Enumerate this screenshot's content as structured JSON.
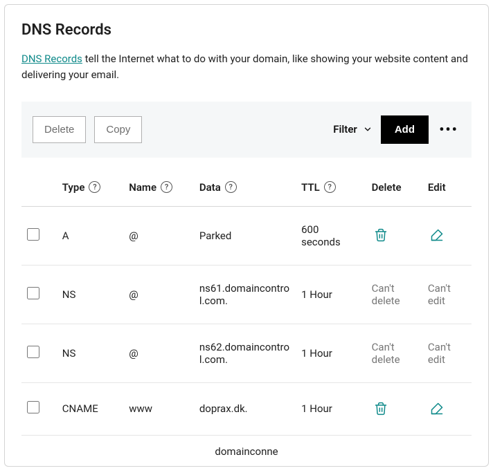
{
  "header": {
    "title": "DNS Records",
    "link_text": "DNS Records",
    "description_rest": " tell the Internet what to do with your domain, like showing your website content and delivering your email."
  },
  "toolbar": {
    "delete_label": "Delete",
    "copy_label": "Copy",
    "filter_label": "Filter",
    "add_label": "Add"
  },
  "table": {
    "headers": {
      "type": "Type",
      "name": "Name",
      "data": "Data",
      "ttl": "TTL",
      "delete": "Delete",
      "edit": "Edit"
    },
    "rows": [
      {
        "type": "A",
        "name": "@",
        "data": "Parked",
        "ttl": "600 seconds",
        "can_delete": true,
        "can_edit": true,
        "delete_text": "",
        "edit_text": ""
      },
      {
        "type": "NS",
        "name": "@",
        "data": "ns61.domaincontrol.com.",
        "ttl": "1 Hour",
        "can_delete": false,
        "can_edit": false,
        "delete_text": "Can't delete",
        "edit_text": "Can't edit"
      },
      {
        "type": "NS",
        "name": "@",
        "data": "ns62.domaincontrol.com.",
        "ttl": "1 Hour",
        "can_delete": false,
        "can_edit": false,
        "delete_text": "Can't delete",
        "edit_text": "Can't edit"
      },
      {
        "type": "CNAME",
        "name": "www",
        "data": "doprax.dk.",
        "ttl": "1 Hour",
        "can_delete": true,
        "can_edit": true,
        "delete_text": "",
        "edit_text": ""
      }
    ],
    "footer_fragment": "domainconne"
  }
}
